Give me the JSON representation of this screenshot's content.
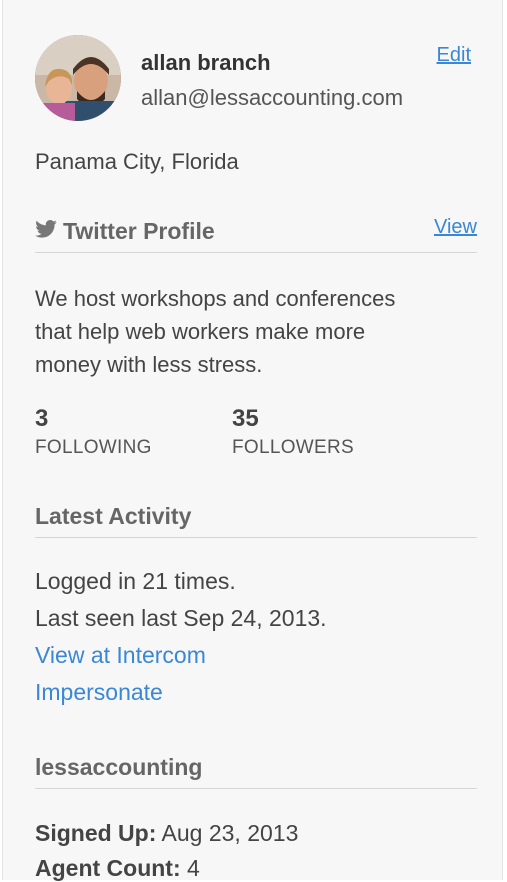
{
  "profile": {
    "name": "allan branch",
    "email": "allan@lessaccounting.com",
    "edit_label": "Edit",
    "location": "Panama City, Florida",
    "avatar_icon": "user-avatar-photo"
  },
  "twitter": {
    "section_title": "Twitter Profile",
    "view_label": "View",
    "icon": "twitter-bird-icon",
    "bio_lines": [
      "We host workshops and conferences",
      "that help web workers make more",
      "money with less stress."
    ],
    "following_count": "3",
    "following_label": "FOLLOWING",
    "followers_count": "35",
    "followers_label": "FOLLOWERS"
  },
  "activity": {
    "section_title": "Latest Activity",
    "logins": "Logged in 21 times.",
    "last_seen": "Last seen last Sep 24, 2013.",
    "view_intercom_label": "View at Intercom",
    "impersonate_label": "Impersonate"
  },
  "company": {
    "section_title": "lessaccounting",
    "signed_up_key": "Signed Up:",
    "signed_up_value": "Aug 23, 2013",
    "agent_count_key": "Agent Count:",
    "agent_count_value": "4"
  },
  "colors": {
    "link": "#3a87d6",
    "panel_bg": "#f7f7f7",
    "section_title": "#666666"
  }
}
